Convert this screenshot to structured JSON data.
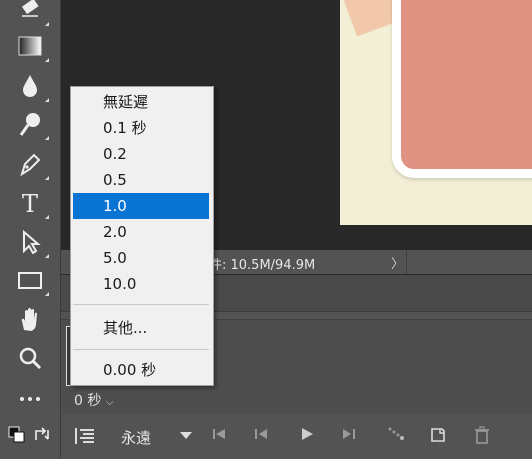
{
  "status_bar": {
    "doc_info": "件: 10.5M/94.9M",
    "expand_icon": "chevron-right-icon"
  },
  "frame": {
    "delay_label": "0 秒"
  },
  "frame_delay_menu": {
    "items": [
      {
        "label": "無延遲",
        "selected": false
      },
      {
        "label": "0.1 秒",
        "selected": false
      },
      {
        "label": "0.2",
        "selected": false
      },
      {
        "label": "0.5",
        "selected": false
      },
      {
        "label": "1.0",
        "selected": true
      },
      {
        "label": "2.0",
        "selected": false
      },
      {
        "label": "5.0",
        "selected": false
      },
      {
        "label": "10.0",
        "selected": false
      }
    ],
    "other": "其他...",
    "current": "0.00 秒"
  },
  "timeline": {
    "loop_label": "永遠"
  },
  "tools": [
    "eraser-icon",
    "gradient-icon",
    "blur-drop-icon",
    "dodge-icon",
    "pen-icon",
    "type-icon",
    "path-selection-icon",
    "rectangle-icon",
    "hand-icon",
    "zoom-icon",
    "more-tools-icon"
  ],
  "colors": {
    "menu_selection": "#0a74d4",
    "canvas_card": "#e09383",
    "canvas_bg": "#f3efd6"
  }
}
